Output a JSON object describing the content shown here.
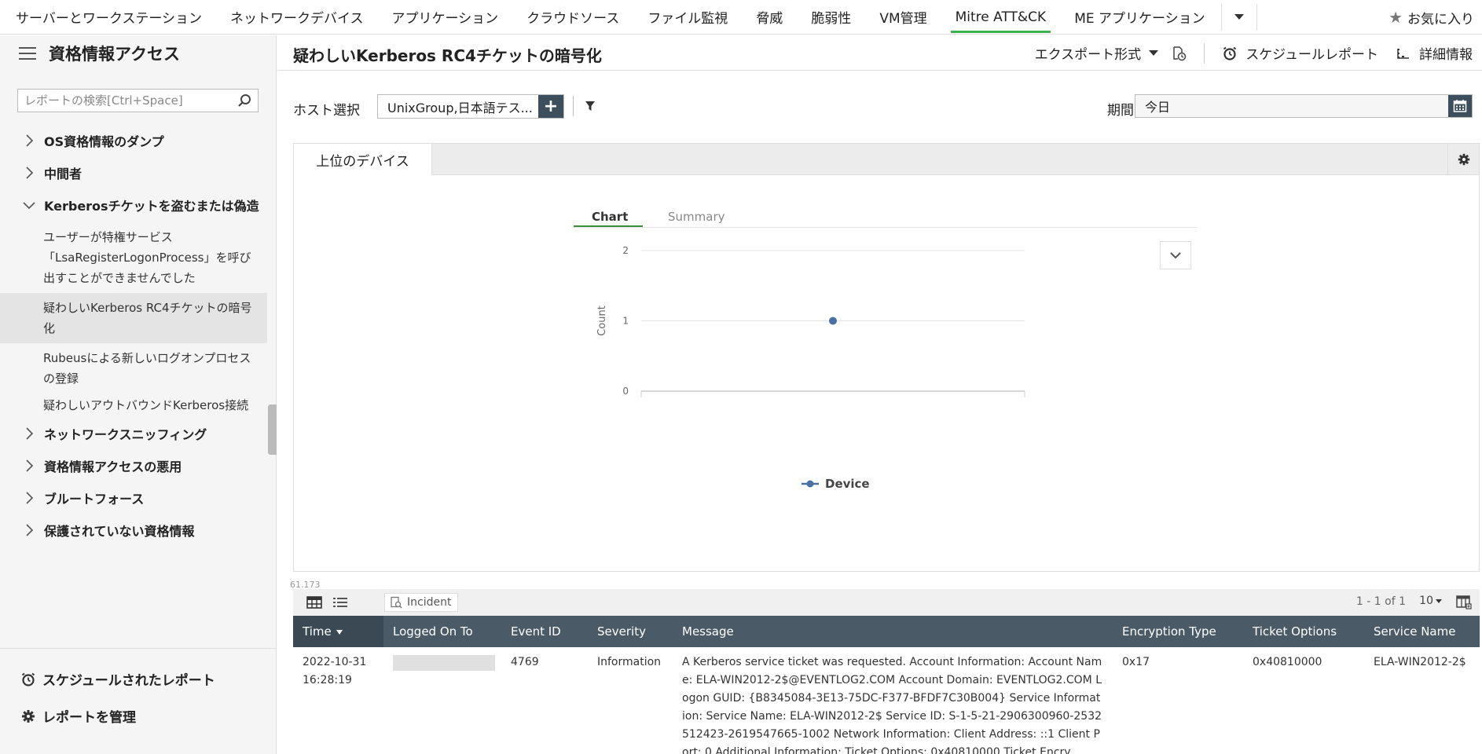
{
  "topnav": {
    "items": [
      "サーバーとワークステーション",
      "ネットワークデバイス",
      "アプリケーション",
      "クラウドソース",
      "ファイル監視",
      "脅威",
      "脆弱性",
      "VM管理",
      "Mitre ATT&CK",
      "ME アプリケーション"
    ],
    "active_index": 8,
    "favorites_label": "お気に入り"
  },
  "sidebar": {
    "title": "資格情報アクセス",
    "search_placeholder": "レポートの検索[Ctrl+Space]",
    "tree": [
      {
        "label": "OS資格情報のダンプ",
        "expanded": false
      },
      {
        "label": "中間者",
        "expanded": false
      },
      {
        "label": "Kerberosチケットを盗むまたは偽造",
        "expanded": true,
        "children": [
          {
            "label": "ユーザーが特権サービス「LsaRegisterLogonProcess」を呼び出すことができませんでした",
            "selected": false
          },
          {
            "label": "疑わしいKerberos RC4チケットの暗号化",
            "selected": true
          },
          {
            "label": "Rubeusによる新しいログオンプロセスの登録",
            "selected": false
          },
          {
            "label": "疑わしいアウトバウンドKerberos接続",
            "selected": false
          }
        ]
      },
      {
        "label": "ネットワークスニッフィング",
        "expanded": false
      },
      {
        "label": "資格情報アクセスの悪用",
        "expanded": false
      },
      {
        "label": "ブルートフォース",
        "expanded": false
      },
      {
        "label": "保護されていない資格情報",
        "expanded": false
      }
    ],
    "bottom": {
      "scheduled_label": "スケジュールされたレポート",
      "manage_label": "レポートを管理"
    }
  },
  "header": {
    "title": "疑わしいKerberos RC4チケットの暗号化",
    "export_label": "エクスポート形式",
    "schedule_label": "スケジュールレポート",
    "details_label": "詳細情報"
  },
  "filters": {
    "host_label": "ホスト選択",
    "host_value": "UnixGroup,日本語テス...",
    "period_label": "期間",
    "period_value": "今日"
  },
  "panel": {
    "tab_label": "上位のデバイス",
    "chart_tabs": [
      "Chart",
      "Summary"
    ]
  },
  "chart_data": {
    "type": "line",
    "x": [
      "Device"
    ],
    "series": [
      {
        "name": "Device",
        "values": [
          1
        ]
      }
    ],
    "ylabel": "Count",
    "ylim": [
      0,
      2
    ],
    "yticks": [
      0,
      1,
      2
    ],
    "legend": "bottom-center",
    "color": "#4a6fa5"
  },
  "grid": {
    "mini_number": "61.173",
    "incident_label": "Incident",
    "page_info": "1 - 1 of 1",
    "per_page": "10",
    "columns": [
      "Time",
      "Logged On To",
      "Event ID",
      "Severity",
      "Message",
      "Encryption Type",
      "Ticket Options",
      "Service Name"
    ],
    "rows": [
      {
        "time": "2022-10-31 16:28:19",
        "logged_on_to": "",
        "event_id": "4769",
        "severity": "Information",
        "message": "A Kerberos service ticket was requested. Account Information: Account Name: ELA-WIN2012-2$@EVENTLOG2.COM Account Domain: EVENTLOG2.COM Logon GUID: {B8345084-3E13-75DC-F377-BFDF7C30B004} Service Information: Service Name: ELA-WIN2012-2$ Service ID: S-1-5-21-2906300960-2532512423-2619547665-1002 Network Information: Client Address: ::1 Client Port: 0 Additional Information: Ticket Options: 0x40810000 Ticket Encry",
        "encryption_type": "0x17",
        "ticket_options": "0x40810000",
        "service_name": "ELA-WIN2012-2$"
      }
    ]
  }
}
